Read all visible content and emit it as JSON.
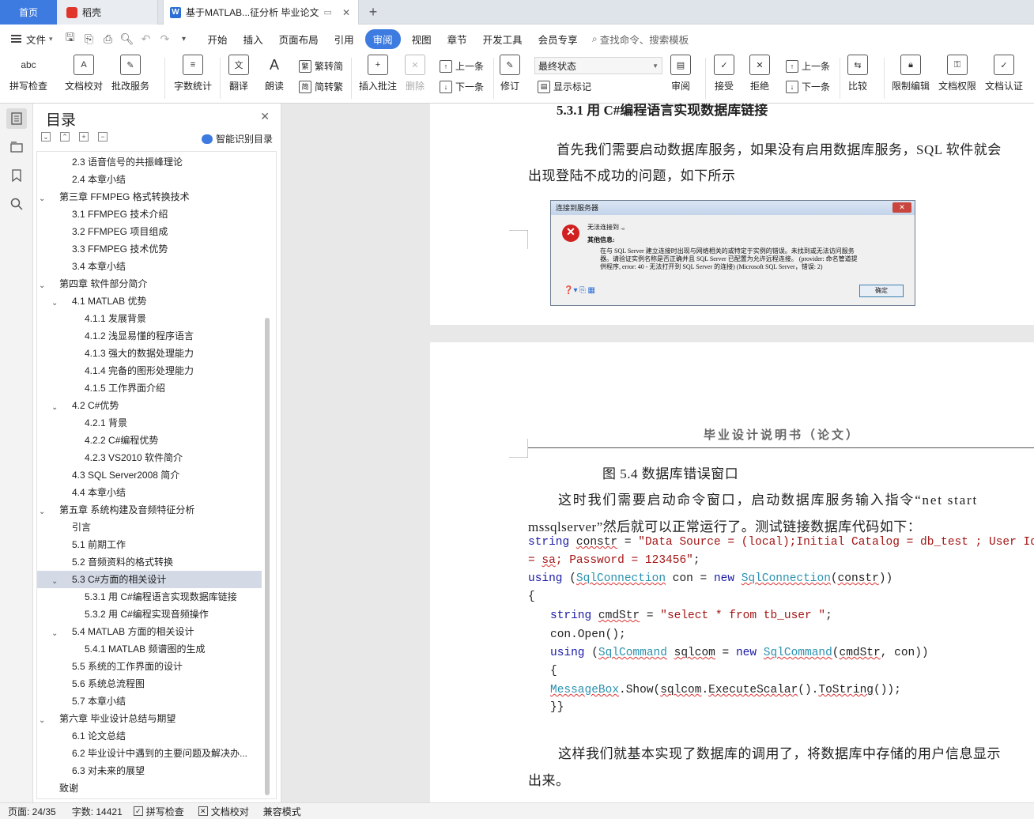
{
  "tabs": {
    "home": "首页",
    "daoke": "稻壳",
    "doc": "基于MATLAB...征分析 毕业论文"
  },
  "menu": {
    "file": "文件",
    "items": [
      "开始",
      "插入",
      "页面布局",
      "引用",
      "审阅",
      "视图",
      "章节",
      "开发工具",
      "会员专享"
    ],
    "search": "查找命令、搜索模板"
  },
  "ribbon": {
    "spell_check": "拼写检查",
    "doc_proof": "文档校对",
    "batch_service": "批改服务",
    "word_count": "字数统计",
    "translate": "翻译",
    "read_aloud": "朗读",
    "trad_convert": "繁转简",
    "simp_convert": "简转繁",
    "insert_comment": "插入批注",
    "delete": "删除",
    "prev": "上一条",
    "next": "下一条",
    "track": "修订",
    "final_state": "最终状态",
    "show_marks": "显示标记",
    "review": "审阅",
    "accept": "接受",
    "reject": "拒绝",
    "prev2": "上一条",
    "next2": "下一条",
    "compare": "比较",
    "restrict_edit": "限制编辑",
    "doc_rights": "文档权限",
    "doc_cert": "文档认证"
  },
  "toc": {
    "title": "目录",
    "smart": "智能识别目录",
    "items": [
      {
        "label": "2.3 语音信号的共振峰理论",
        "level": 2,
        "chev": ""
      },
      {
        "label": "2.4 本章小结",
        "level": 2,
        "chev": ""
      },
      {
        "label": "第三章  FFMPEG 格式转换技术",
        "level": 1,
        "chev": "open"
      },
      {
        "label": "3.1 FFMPEG 技术介绍",
        "level": 2,
        "chev": ""
      },
      {
        "label": "3.2 FFMPEG 项目组成",
        "level": 2,
        "chev": ""
      },
      {
        "label": "3.3 FFMPEG 技术优势",
        "level": 2,
        "chev": ""
      },
      {
        "label": "3.4 本章小结",
        "level": 2,
        "chev": ""
      },
      {
        "label": "第四章  软件部分简介",
        "level": 1,
        "chev": "open"
      },
      {
        "label": "4.1 MATLAB 优势",
        "level": 2,
        "chev": "open"
      },
      {
        "label": "4.1.1 发展背景",
        "level": 3,
        "chev": ""
      },
      {
        "label": "4.1.2  浅显易懂的程序语言",
        "level": 3,
        "chev": ""
      },
      {
        "label": "4.1.3  强大的数据处理能力",
        "level": 3,
        "chev": ""
      },
      {
        "label": "4.1.4  完备的图形处理能力",
        "level": 3,
        "chev": ""
      },
      {
        "label": "4.1.5  工作界面介绍",
        "level": 3,
        "chev": ""
      },
      {
        "label": "4.2 C#优势",
        "level": 2,
        "chev": "open"
      },
      {
        "label": "4.2.1 背景",
        "level": 3,
        "chev": ""
      },
      {
        "label": "4.2.2 C#编程优势",
        "level": 3,
        "chev": ""
      },
      {
        "label": "4.2.3 VS2010 软件简介",
        "level": 3,
        "chev": ""
      },
      {
        "label": "4.3 SQL Server2008 简介",
        "level": 2,
        "chev": ""
      },
      {
        "label": "4.4  本章小结",
        "level": 2,
        "chev": ""
      },
      {
        "label": "第五章  系统构建及音频特征分析",
        "level": 1,
        "chev": "open"
      },
      {
        "label": "引言",
        "level": 2,
        "chev": ""
      },
      {
        "label": "5.1  前期工作",
        "level": 2,
        "chev": ""
      },
      {
        "label": "5.2  音频资料的格式转换",
        "level": 2,
        "chev": ""
      },
      {
        "label": "5.3 C#方面的相关设计",
        "level": 2,
        "chev": "open",
        "selected": true
      },
      {
        "label": "5.3.1 用 C#编程语言实现数据库链接",
        "level": 3,
        "chev": ""
      },
      {
        "label": "5.3.2  用 C#编程实现音频操作",
        "level": 3,
        "chev": ""
      },
      {
        "label": "5.4 MATLAB 方面的相关设计",
        "level": 2,
        "chev": "open"
      },
      {
        "label": "5.4.1 MATLAB 频谱图的生成",
        "level": 3,
        "chev": ""
      },
      {
        "label": "5.5 系统的工作界面的设计",
        "level": 2,
        "chev": ""
      },
      {
        "label": "5.6  系统总流程图",
        "level": 2,
        "chev": ""
      },
      {
        "label": "5.7  本章小结",
        "level": 2,
        "chev": ""
      },
      {
        "label": "第六章  毕业设计总结与期望",
        "level": 1,
        "chev": "open"
      },
      {
        "label": "6.1 论文总结",
        "level": 2,
        "chev": ""
      },
      {
        "label": "6.2  毕业设计中遇到的主要问题及解决办...",
        "level": 2,
        "chev": ""
      },
      {
        "label": "6.3  对未来的展望",
        "level": 2,
        "chev": ""
      },
      {
        "label": "致谢",
        "level": 1,
        "chev": ""
      }
    ]
  },
  "doc": {
    "heading": "5.3.1 用 C#编程语言实现数据库链接",
    "p1_line1": "首先我们需要启动数据库服务，如果没有启用数据库服务，SQL 软件就会",
    "p1_line2": "出现登陆不成功的问题，如下所示",
    "dialog": {
      "title": "连接到服务器",
      "line1": "无法连接到 .。",
      "line2": "其他信息:",
      "line3": "在与 SQL Server 建立连接时出现与网络相关的或特定于实例的错误。未找到或无法访问服务",
      "line4": "器。请验证实例名称是否正确并且 SQL Server 已配置为允许远程连接。 (provider: 命名管道提",
      "line5": "供程序, error: 40 - 无法打开到 SQL Server 的连接) (Microsoft SQL Server，错误: 2)",
      "ok": "确定"
    },
    "header": "毕业设计说明书（论文）",
    "figure_caption": "图 5.4  数据库错误窗口",
    "p2_line1": "这时我们需要启动命令窗口，启动数据库服务输入指令“net start",
    "p2_line2": "mssqlserver”然后就可以正常运行了。测试链接数据库代码如下：",
    "code": {
      "l1a": "string ",
      "l1b": "constr",
      "l1c": " = ",
      "l1d": "\"Data Source = (local);Initial Catalog = db_test ; User Id",
      "l2a": "= ",
      "l2b": "sa",
      "l2c": "; Password = 123456\"",
      "l2d": ";",
      "l3a": "using",
      "l3b": " (",
      "l3c": "SqlConnection",
      "l3d": " con = ",
      "l3e": "new",
      "l3f": " ",
      "l3g": "SqlConnection",
      "l3h": "(",
      "l3i": "constr",
      "l3j": "))",
      "l4": "{",
      "l5a": "string",
      "l5b": " ",
      "l5c": "cmdStr",
      "l5d": " = ",
      "l5e": "\"select * from tb_user \"",
      "l5f": ";",
      "l6": "con.Open();",
      "l7a": "using",
      "l7b": " (",
      "l7c": "SqlCommand",
      "l7d": " ",
      "l7e": "sqlcom",
      "l7f": " = ",
      "l7g": "new",
      "l7h": " ",
      "l7i": "SqlCommand",
      "l7j": "(",
      "l7k": "cmdStr",
      "l7l": ", con))",
      "l8": "{",
      "l9a": "MessageBox",
      "l9b": ".Show(",
      "l9c": "sqlcom",
      "l9d": ".",
      "l9e": "ExecuteScalar",
      "l9f": "().",
      "l9g": "ToString",
      "l9h": "());",
      "l10": "}}"
    },
    "p3_line1": "这样我们就基本实现了数据库的调用了，将数据库中存储的用户信息显示",
    "p3_line2": "出来。"
  },
  "status": {
    "page": "页面: 24/35",
    "words": "字数: 14421",
    "spell": "拼写检查",
    "proof": "文档校对",
    "compat": "兼容模式"
  },
  "colors": {
    "accent": "#3d7be0",
    "selected_toc": "#d3dae5"
  }
}
